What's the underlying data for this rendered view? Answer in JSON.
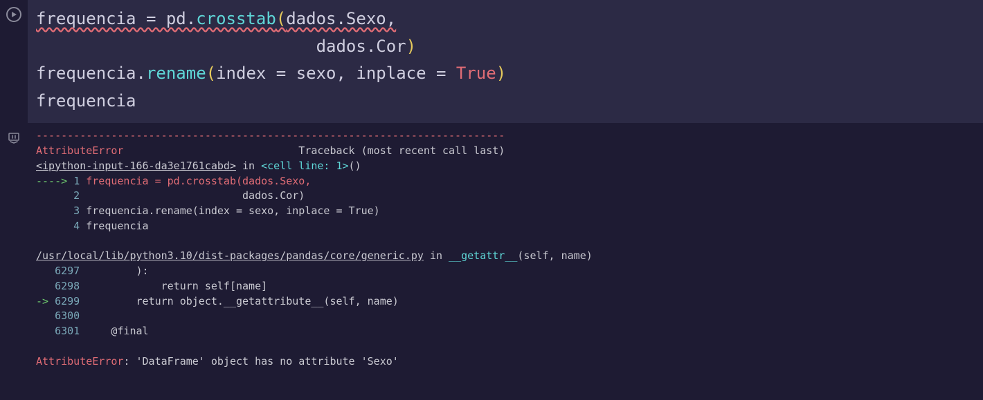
{
  "code": {
    "line1": {
      "a": "frequencia = pd.",
      "b": "crosstab",
      "c": "(",
      "d": "dados.Sexo,"
    },
    "line2": {
      "pad": "                            ",
      "a": "dados.Cor",
      "b": ")"
    },
    "line3": {
      "a": "frequencia.",
      "b": "rename",
      "c": "(",
      "d": "index = sexo, inplace = ",
      "e": "True",
      "f": ")"
    },
    "line4": "frequencia"
  },
  "output": {
    "dashes": "---------------------------------------------------------------------------",
    "err_name": "AttributeError",
    "tb_label": "                            Traceback (most recent call last)",
    "ipy_link": "<ipython-input-166-da3e1761cabd>",
    "in_word": " in ",
    "cell_line": "<cell line: 1>",
    "paren": "()",
    "l1_arrow": "----> ",
    "l1_num": "1",
    "l1_code": " frequencia = pd.crosstab(dados.Sexo,",
    "l2_num": "      2",
    "l2_code": "                          dados.Cor)",
    "l3_num": "      3",
    "l3_code": " frequencia.rename(index = sexo, inplace = True)",
    "l4_num": "      4",
    "l4_code": " frequencia",
    "py_link": "/usr/local/lib/python3.10/dist-packages/pandas/core/generic.py",
    "getattr": "__getattr__",
    "sig": "(self, name)",
    "g6297n": "   6297",
    "g6297c": "         ):",
    "g6298n": "   6298",
    "g6298c": "             return self[name]",
    "g6299a": "-> ",
    "g6299n": "6299",
    "g6299c": "         return object.__getattribute__(self, name)",
    "g6300n": "   6300",
    "g6300c": "",
    "g6301n": "   6301",
    "g6301c": "     @final",
    "final_err": "AttributeError",
    "final_msg": ": 'DataFrame' object has no attribute 'Sexo'"
  }
}
